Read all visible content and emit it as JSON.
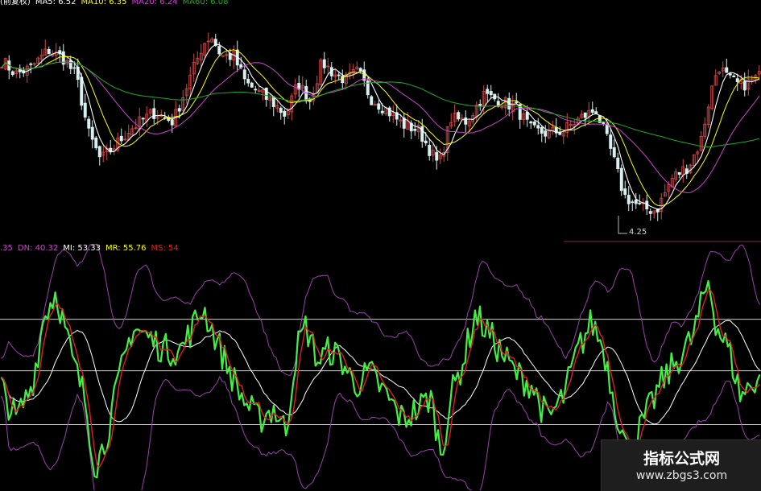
{
  "colors": {
    "background": "#000000",
    "candle_up": "#d24a4a",
    "candle_down": "#d8f0f0",
    "ma5": "#ffffff",
    "ma10": "#ffff00",
    "ma20": "#cc44cc",
    "ma60": "#22aa22",
    "mi": "#ffffff",
    "mr": "#ffff00",
    "ms": "#dd2222",
    "osc_line": "#44ee44",
    "band": "#9a44aa",
    "hline": "#cfcfcf"
  },
  "header_top": {
    "items": [
      {
        "text": "(前复权)",
        "color": "#ffffff"
      },
      {
        "text": "MA5: 6.52",
        "color": "#ffffff"
      },
      {
        "text": "MA10: 6.35",
        "color": "#ffff00"
      },
      {
        "text": "MA20: 6.24",
        "color": "#cc44cc"
      },
      {
        "text": "MA60: 6.08",
        "color": "#22aa22"
      }
    ]
  },
  "header_indicator": {
    "items": [
      {
        "text": ".35",
        "color": "#cc44cc"
      },
      {
        "text": "DN: 40.32",
        "color": "#cc44cc"
      },
      {
        "text": "MI: 53.33",
        "color": "#ffffff"
      },
      {
        "text": "MR: 55.76",
        "color": "#ffff00"
      },
      {
        "text": "MS: 54",
        "color": "#dd2222"
      }
    ]
  },
  "price_chart": {
    "low_marker_label": "4.25"
  },
  "watermark": {
    "title": "指标公式网",
    "url": "www.zbgs3.com"
  },
  "chart_data": [
    {
      "type": "line",
      "x_keypoints": [
        0,
        20,
        38,
        60,
        80,
        95,
        110,
        125,
        140,
        160,
        190,
        215,
        235,
        252,
        262,
        275,
        290,
        305,
        320,
        340,
        355,
        370,
        385,
        400,
        415,
        430,
        445,
        460,
        480,
        500,
        520,
        545,
        560,
        580,
        600,
        620,
        640,
        660,
        680,
        700,
        720,
        740,
        760,
        775,
        795,
        815,
        835,
        855,
        870,
        882,
        892,
        905,
        920,
        945
      ],
      "price_path": [
        6.8,
        6.55,
        6.65,
        6.95,
        6.8,
        6.5,
        5.55,
        5.1,
        5.3,
        5.6,
        5.9,
        5.75,
        6.45,
        7.05,
        7.2,
        6.85,
        6.85,
        6.4,
        6.25,
        6.05,
        5.85,
        6.4,
        6.1,
        6.75,
        6.55,
        6.45,
        6.6,
        6.15,
        5.95,
        5.7,
        5.6,
        5.0,
        5.8,
        5.75,
        6.2,
        6.1,
        6.0,
        5.6,
        5.55,
        5.6,
        5.8,
        5.95,
        5.2,
        4.5,
        4.3,
        4.25,
        4.8,
        5.0,
        5.4,
        6.2,
        6.7,
        6.45,
        6.35,
        6.52
      ],
      "series": [
        {
          "name": "MA5",
          "value": 6.52
        },
        {
          "name": "MA10",
          "value": 6.35
        },
        {
          "name": "MA20",
          "value": 6.24
        },
        {
          "name": "MA60",
          "value": 6.08
        }
      ],
      "annotations": [
        "4.25"
      ]
    },
    {
      "type": "line",
      "x_keypoints": [
        0,
        20,
        40,
        55,
        70,
        90,
        105,
        118,
        130,
        150,
        165,
        185,
        205,
        225,
        240,
        252,
        262,
        280,
        300,
        320,
        340,
        355,
        368,
        380,
        395,
        410,
        425,
        440,
        460,
        480,
        500,
        520,
        535,
        548,
        560,
        575,
        590,
        605,
        620,
        640,
        660,
        680,
        700,
        718,
        735,
        750,
        765,
        780,
        800,
        820,
        840,
        860,
        872,
        880,
        890,
        905,
        920,
        945
      ],
      "oscillator_path": [
        45,
        30,
        45,
        75,
        85,
        55,
        40,
        10,
        20,
        50,
        70,
        65,
        60,
        60,
        70,
        78,
        70,
        55,
        40,
        30,
        35,
        25,
        60,
        70,
        55,
        60,
        55,
        45,
        50,
        40,
        30,
        35,
        40,
        15,
        40,
        55,
        75,
        68,
        60,
        50,
        45,
        30,
        40,
        60,
        72,
        60,
        35,
        15,
        30,
        45,
        55,
        65,
        80,
        90,
        70,
        60,
        40,
        50
      ],
      "reference_levels": [
        73,
        51,
        28
      ],
      "series": [
        {
          "name": "DN",
          "value": 40.32
        },
        {
          "name": "MI",
          "value": 53.33
        },
        {
          "name": "MR",
          "value": 55.76
        },
        {
          "name": "MS",
          "value": 54
        }
      ]
    }
  ]
}
